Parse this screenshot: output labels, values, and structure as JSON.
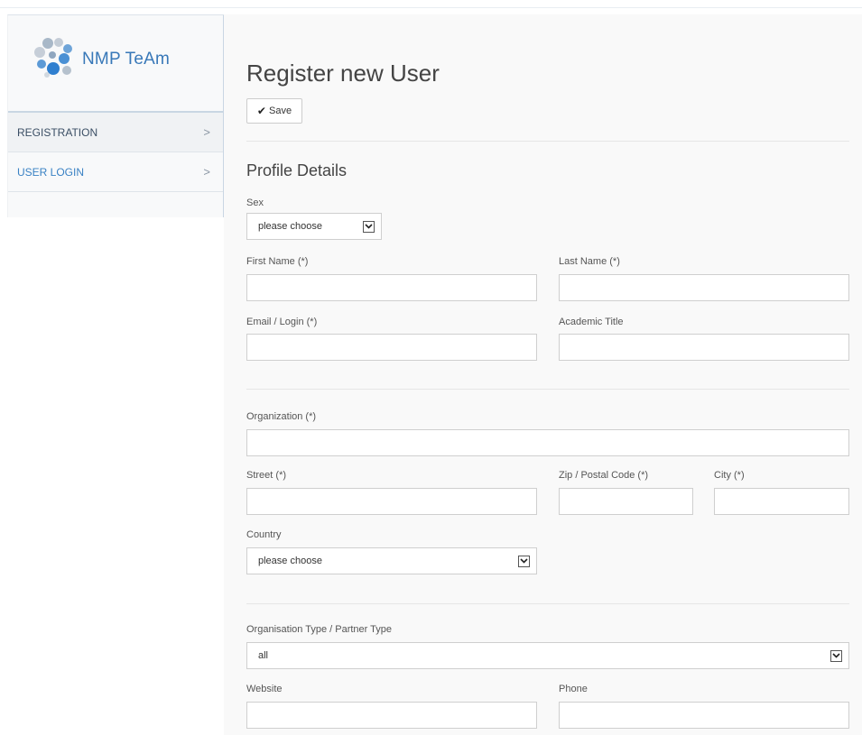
{
  "brand": {
    "name": "NMP TeAm"
  },
  "sidebar": {
    "items": [
      {
        "label": "REGISTRATION",
        "chevron": ">"
      },
      {
        "label": "USER LOGIN",
        "chevron": ">"
      }
    ]
  },
  "page": {
    "title": "Register new User",
    "save_label": "Save"
  },
  "profile": {
    "heading": "Profile Details",
    "sex_label": "Sex",
    "sex_value": "please choose",
    "first_name_label": "First Name (*)",
    "last_name_label": "Last Name (*)",
    "email_label": "Email / Login (*)",
    "academic_title_label": "Academic Title"
  },
  "address": {
    "organization_label": "Organization (*)",
    "street_label": "Street (*)",
    "zip_label": "Zip / Postal Code (*)",
    "city_label": "City (*)",
    "country_label": "Country",
    "country_value": "please choose"
  },
  "extra": {
    "org_type_label": "Organisation Type / Partner Type",
    "org_type_value": "all",
    "website_label": "Website",
    "phone_label": "Phone"
  },
  "colors": {
    "brand_blue": "#3878b8",
    "link_blue": "#3a82c4",
    "sidebar_border": "#c9d6e3"
  }
}
